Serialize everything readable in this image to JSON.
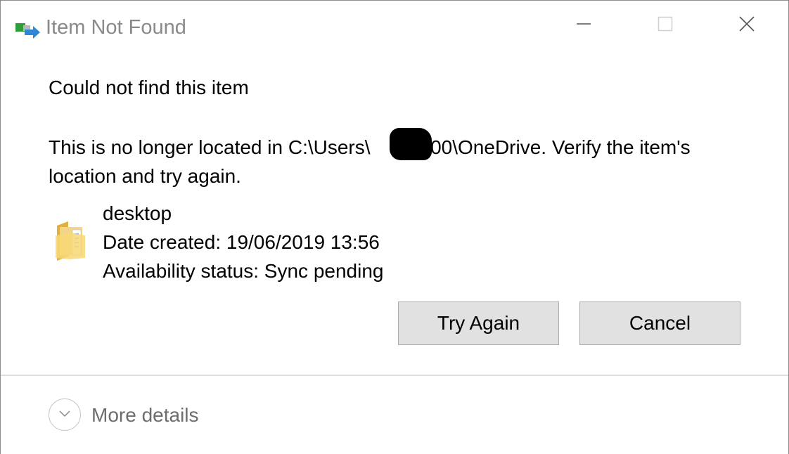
{
  "window": {
    "title": "Item Not Found",
    "app_icon": "move-file-icon",
    "controls": {
      "minimize": "minimize-icon",
      "maximize": "maximize-icon",
      "close": "close-icon"
    }
  },
  "message": {
    "main_instruction": "Could not find this item",
    "content": "This is no longer located in C:\\Users\\     000\\OneDrive. Verify the item's location and try again."
  },
  "item": {
    "icon": "folder-icon",
    "name": "desktop",
    "date_created": "Date created: 19/06/2019 13:56",
    "availability": "Availability status: Sync pending"
  },
  "buttons": {
    "try_again": "Try Again",
    "cancel": "Cancel"
  },
  "footer": {
    "more_details_label": "More details",
    "toggle_icon": "chevron-down-icon"
  },
  "colors": {
    "button_face": "#e1e1e1",
    "button_border": "#adadad",
    "title_text": "#8a8a8a",
    "footer_text": "#6d6d6d"
  }
}
